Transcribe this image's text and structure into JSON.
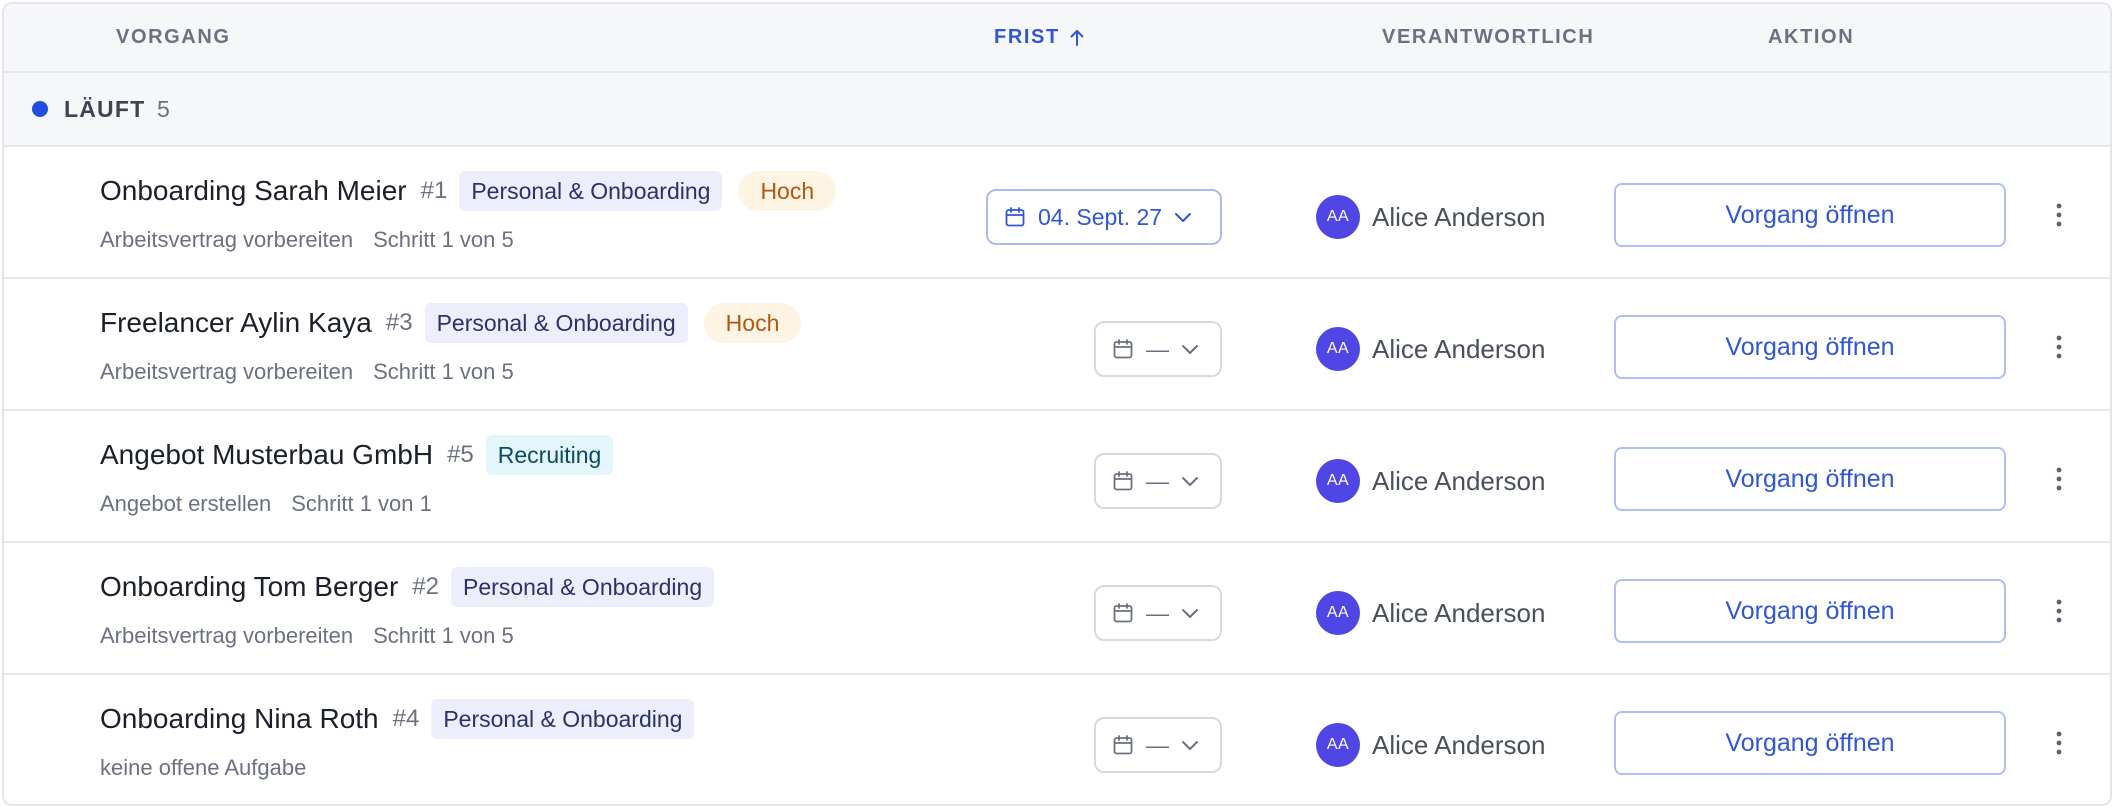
{
  "columns": {
    "vorgang": "VORGANG",
    "frist": "FRIST",
    "verantwortlich": "VERANTWORTLICH",
    "aktion": "AKTION"
  },
  "sort_icon": "arrow-up-icon",
  "group": {
    "label": "LÄUFT",
    "count": "5",
    "color": "#1f4fe0"
  },
  "rows": [
    {
      "title": "Onboarding Sarah Meier",
      "num": "#1",
      "category": "Personal & Onboarding",
      "priority": "Hoch",
      "step": "Arbeitsvertrag vorbereiten",
      "progress": "Schritt 1 von 5",
      "due": "04. Sept. 27",
      "assignee_initials": "AA",
      "assignee": "Alice Anderson",
      "action": "Vorgang öffnen"
    },
    {
      "title": "Freelancer Aylin Kaya",
      "num": "#3",
      "category": "Personal & Onboarding",
      "priority": "Hoch",
      "step": "Arbeitsvertrag vorbereiten",
      "progress": "Schritt 1 von 5",
      "due": "—",
      "assignee_initials": "AA",
      "assignee": "Alice Anderson",
      "action": "Vorgang öffnen"
    },
    {
      "title": "Angebot Musterbau GmbH",
      "num": "#5",
      "category": "Recruiting",
      "step": "Angebot erstellen",
      "progress": "Schritt 1 von 1",
      "due": "—",
      "assignee_initials": "AA",
      "assignee": "Alice Anderson",
      "action": "Vorgang öffnen"
    },
    {
      "title": "Onboarding Tom Berger",
      "num": "#2",
      "category": "Personal & Onboarding",
      "step": "Arbeitsvertrag vorbereiten",
      "progress": "Schritt 1 von 5",
      "due": "—",
      "assignee_initials": "AA",
      "assignee": "Alice Anderson",
      "action": "Vorgang öffnen"
    },
    {
      "title": "Onboarding Nina Roth",
      "num": "#4",
      "category": "Personal & Onboarding",
      "step": "keine offene Aufgabe",
      "due": "—",
      "assignee_initials": "AA",
      "assignee": "Alice Anderson",
      "action": "Vorgang öffnen"
    }
  ],
  "colors": {
    "accent": "#3056d3",
    "avatar": "#4f46e5",
    "priority_bg": "#fdf4e4",
    "priority_text": "#b5560e",
    "category_bg": "#eceefb",
    "recruiting_bg": "#e2f6fb"
  }
}
